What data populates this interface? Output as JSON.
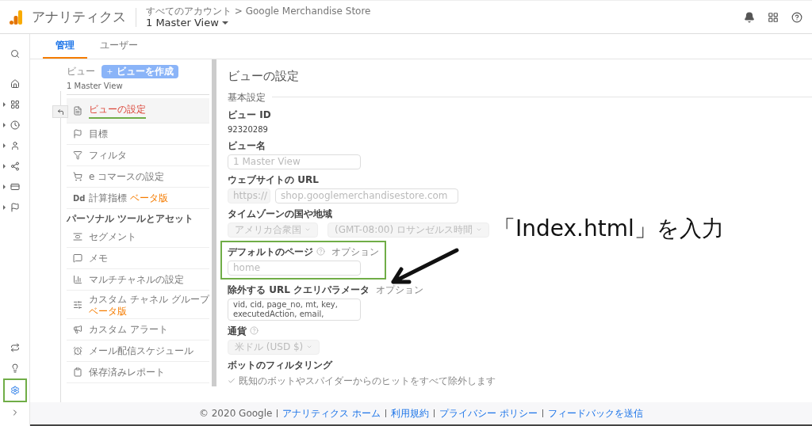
{
  "header": {
    "app_name": "アナリティクス",
    "breadcrumb": "すべてのアカウント > Google Merchandise Store",
    "view_selector": "1 Master View"
  },
  "nav_rail": {
    "top": [
      {
        "selected": false,
        "expandable": false
      },
      {
        "selected": false,
        "expandable": false
      },
      {
        "selected": false,
        "expandable": true
      },
      {
        "selected": false,
        "expandable": true
      },
      {
        "selected": false,
        "expandable": true
      },
      {
        "selected": false,
        "expandable": true
      },
      {
        "selected": false,
        "expandable": true
      },
      {
        "selected": false,
        "expandable": true
      }
    ],
    "bottom": [
      {
        "selected": false,
        "highlighted": false
      },
      {
        "selected": false,
        "highlighted": false
      },
      {
        "selected": true,
        "highlighted": true
      },
      {
        "selected": false,
        "highlighted": false
      }
    ]
  },
  "tabs": [
    {
      "label": "管理",
      "selected": true
    },
    {
      "label": "ユーザー",
      "selected": false
    }
  ],
  "view_column": {
    "label": "ビュー",
    "create_button": "ビューを作成",
    "view_name": "1 Master View",
    "menu": [
      {
        "kind": "item",
        "label": "ビューの設定",
        "selected": true
      },
      {
        "kind": "item",
        "label": "目標",
        "selected": false
      },
      {
        "kind": "item",
        "label": "フィルタ",
        "selected": false
      },
      {
        "kind": "item",
        "label": "e コマースの設定",
        "selected": false
      },
      {
        "kind": "item",
        "label": "計算指標",
        "icon_text": "Dd",
        "badge": "ベータ版",
        "selected": false
      },
      {
        "kind": "heading",
        "label": "パーソナル ツールとアセット"
      },
      {
        "kind": "item",
        "label": "セグメント",
        "selected": false
      },
      {
        "kind": "item",
        "label": "メモ",
        "selected": false
      },
      {
        "kind": "item",
        "label": "マルチチャネルの設定",
        "selected": false
      },
      {
        "kind": "item",
        "label": "カスタム チャネル グループ",
        "badge": "ベータ版",
        "badge_below": true,
        "selected": false
      },
      {
        "kind": "item",
        "label": "カスタム アラート",
        "selected": false
      },
      {
        "kind": "item",
        "label": "メール配信スケジュール",
        "selected": false
      },
      {
        "kind": "item",
        "label": "保存済みレポート",
        "selected": false
      }
    ]
  },
  "settings": {
    "title": "ビューの設定",
    "section": "基本設定",
    "fields": [
      {
        "kind": "text",
        "label": "ビュー ID",
        "value": "92320289"
      },
      {
        "kind": "input",
        "label": "ビュー名",
        "value": "1 Master View",
        "disabled": true
      },
      {
        "kind": "url",
        "label": "ウェブサイトの URL",
        "protocol": "https://",
        "value": "shop.googlemerchandisestore.com",
        "disabled": true
      },
      {
        "kind": "selects",
        "label": "タイムゾーンの国や地域",
        "options": [
          "アメリカ合衆国",
          "(GMT-08:00) ロサンゼルス時間"
        ]
      },
      {
        "kind": "input",
        "label": "デフォルトのページ",
        "help": true,
        "optional": "オプション",
        "placeholder": "home",
        "highlighted": true
      },
      {
        "kind": "textarea",
        "label": "除外する URL クエリパラメータ",
        "optional": "オプション",
        "value": "vid, cid, page_no, mt, key, executedAction, email,"
      },
      {
        "kind": "select",
        "label": "通貨",
        "help": true,
        "value": "米ドル (USD $)"
      },
      {
        "kind": "checkbox",
        "label": "ボットのフィルタリング",
        "option": "既知のボットやスパイダーからのヒットをすべて除外します",
        "checked": true
      }
    ]
  },
  "annotation": {
    "text": "「Index.html」を入力"
  },
  "footer": {
    "copyright": "© 2020 Google",
    "links": [
      "アナリティクス ホーム",
      "利用規約",
      "プライバシー ポリシー",
      "フィードバックを送信"
    ]
  }
}
